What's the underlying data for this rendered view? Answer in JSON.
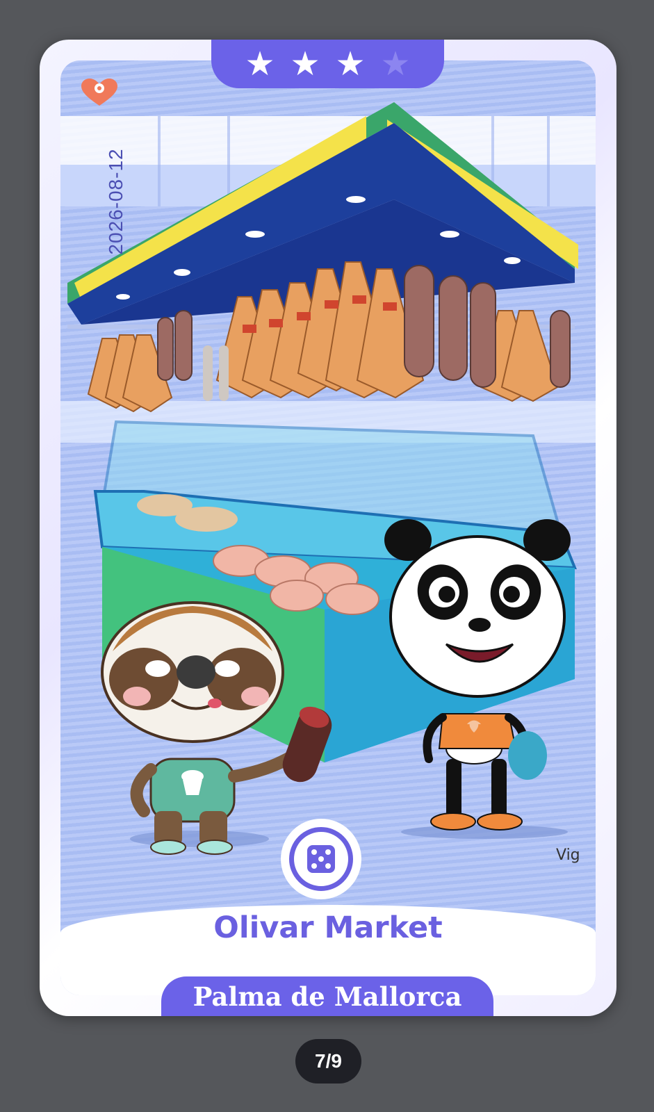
{
  "card": {
    "stars": {
      "filled": 3,
      "total": 4
    },
    "date": "2026-08-12",
    "artist_signature": "Vig",
    "place_name": "Olivar Market",
    "city": "Palma de Mallorca",
    "icons": {
      "location": "heart-pin-icon",
      "randomize": "dice-icon",
      "shirt": "cupcake-icon"
    },
    "colors": {
      "accent": "#6b62e8",
      "background": "#55575b",
      "pin": "#f0795a"
    }
  },
  "pager": {
    "label": "7/9"
  }
}
